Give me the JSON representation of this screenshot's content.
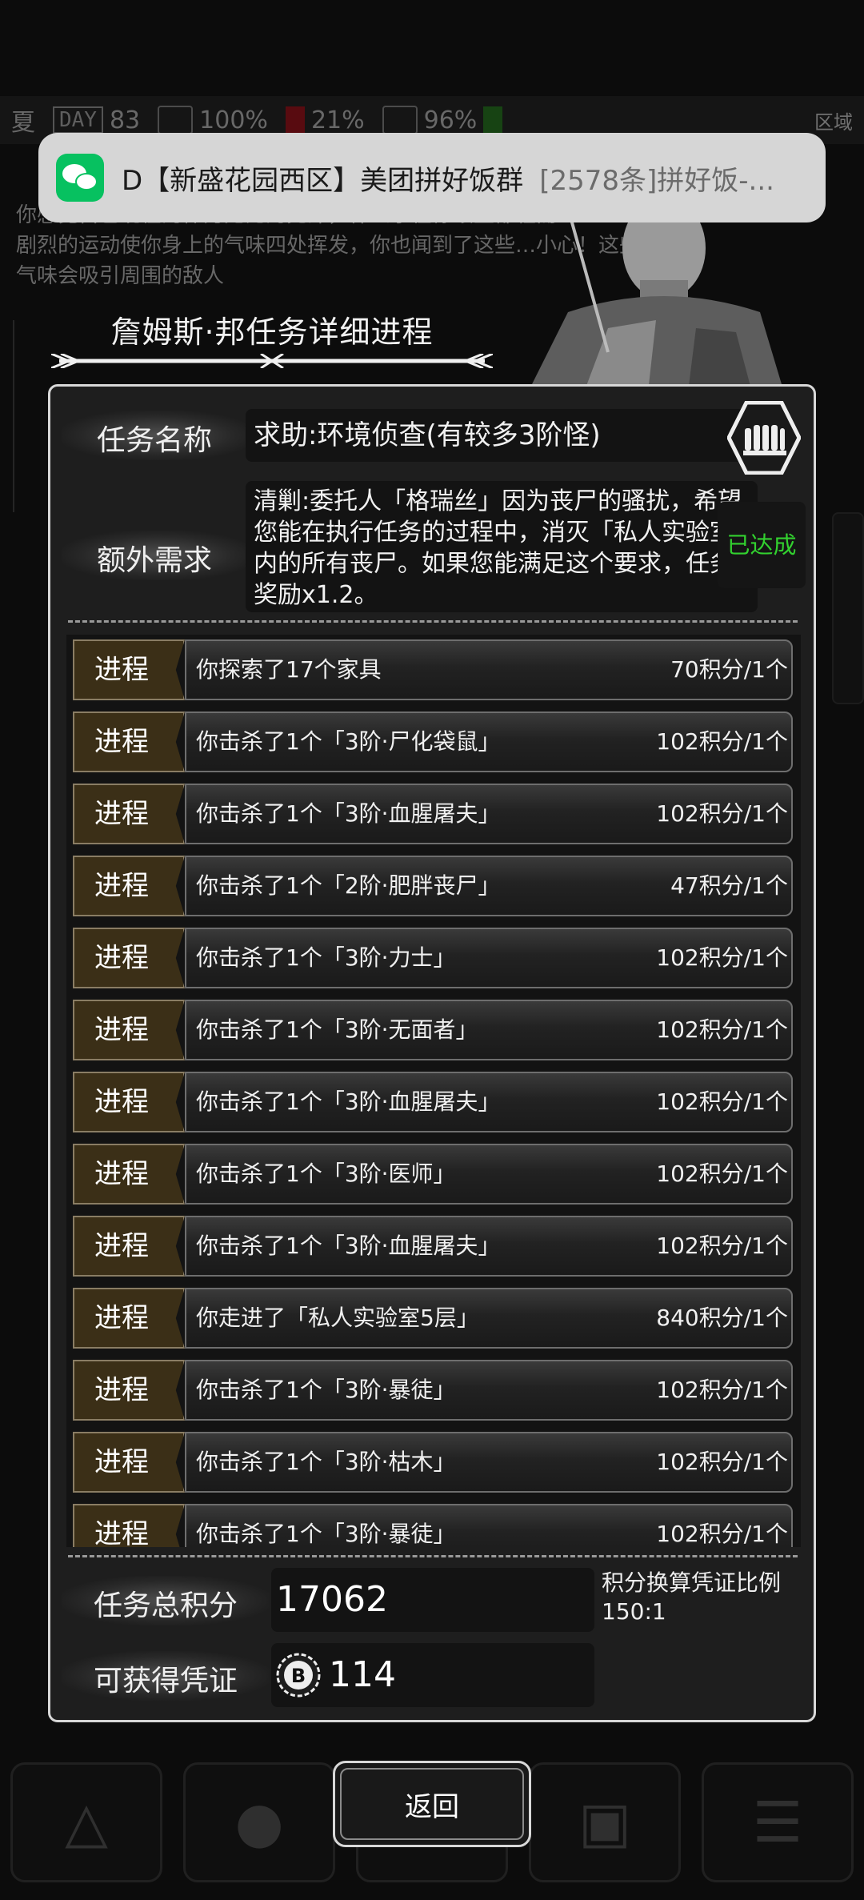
{
  "background": {
    "status": {
      "season": "夏",
      "day_label": "DAY",
      "day": "83",
      "stat1": "100%",
      "stat2": "21%",
      "stat3": "96%",
      "region": "区域"
    },
    "log_lines": [
      "你感觉自己现在的体力无比的充沛，什么事在你眼里都轻而",
      "剧烈的运动使你身上的气味四处挥发，你也闻到了这些…小心！这些",
      "气味会吸引周围的敌人"
    ]
  },
  "notification": {
    "icon": "wechat-icon",
    "title": "D【新盛花园西区】美团拼好饭群",
    "message": "[2578条]拼好饭-..."
  },
  "dialog": {
    "title": "詹姆斯·邦任务详细进程",
    "task_name_label": "任务名称",
    "task_name": "求助:环境侦查(有较多3阶怪)",
    "extra_label": "额外需求",
    "extra_text": "清剿:委托人「格瑞丝」因为丧尸的骚扰，希望您能在执行任务的过程中，消灭「私人实验室」内的所有丧尸。如果您能满足这个要求，任务奖励x1.2。",
    "extra_status": "已达成",
    "extra_status_color": "#32d12f",
    "progress_tag": "进程",
    "progress_items": [
      {
        "text": "你探索了17个家具",
        "points": "70积分/1个"
      },
      {
        "text": "你击杀了1个「3阶·尸化袋鼠」",
        "points": "102积分/1个"
      },
      {
        "text": "你击杀了1个「3阶·血腥屠夫」",
        "points": "102积分/1个"
      },
      {
        "text": "你击杀了1个「2阶·肥胖丧尸」",
        "points": "47积分/1个"
      },
      {
        "text": "你击杀了1个「3阶·力士」",
        "points": "102积分/1个"
      },
      {
        "text": "你击杀了1个「3阶·无面者」",
        "points": "102积分/1个"
      },
      {
        "text": "你击杀了1个「3阶·血腥屠夫」",
        "points": "102积分/1个"
      },
      {
        "text": "你击杀了1个「3阶·医师」",
        "points": "102积分/1个"
      },
      {
        "text": "你击杀了1个「3阶·血腥屠夫」",
        "points": "102积分/1个"
      },
      {
        "text": "你走进了「私人实验室5层」",
        "points": "840积分/1个"
      },
      {
        "text": "你击杀了1个「3阶·暴徒」",
        "points": "102积分/1个"
      },
      {
        "text": "你击杀了1个「3阶·枯木」",
        "points": "102积分/1个"
      },
      {
        "text": "你击杀了1个「3阶·暴徒」",
        "points": "102积分/1个"
      }
    ],
    "total_label": "任务总积分",
    "total_value": "17062",
    "ratio_label": "积分换算凭证比例",
    "ratio_value": "150:1",
    "voucher_label": "可获得凭证",
    "voucher_value": "114",
    "return_label": "返回"
  }
}
